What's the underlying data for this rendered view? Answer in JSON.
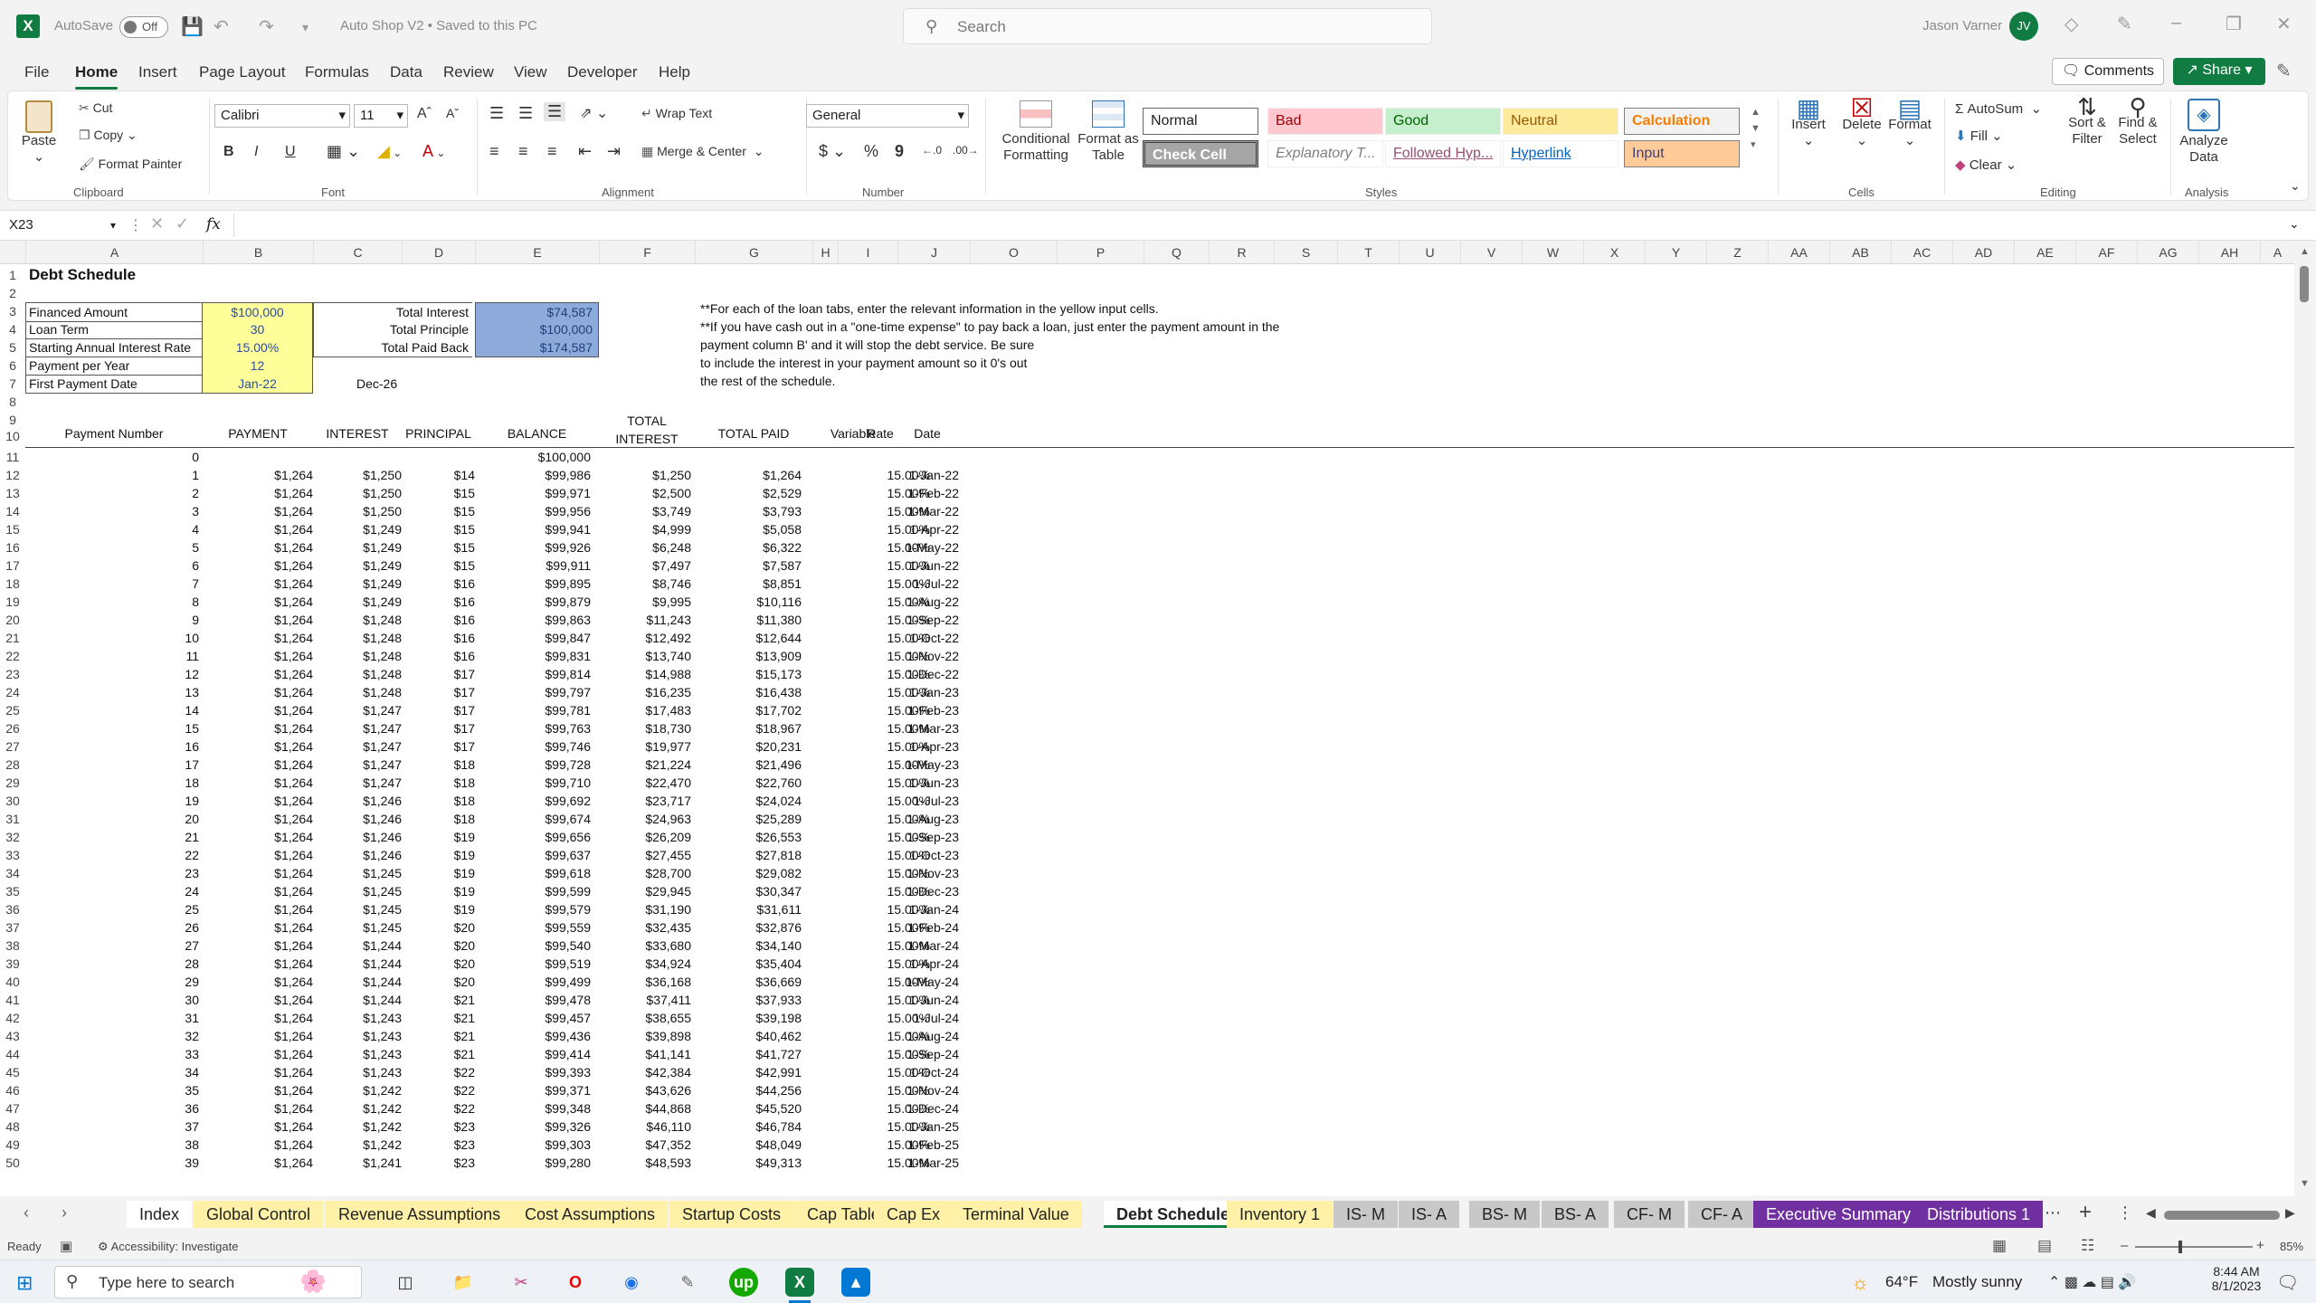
{
  "titlebar": {
    "autosave_label": "AutoSave",
    "autosave_state": "Off",
    "doc_title": "Auto Shop V2 • Saved to this PC",
    "search_placeholder": "Search",
    "user_name": "Jason Varner",
    "user_initials": "JV"
  },
  "menu": {
    "items": [
      "File",
      "Home",
      "Insert",
      "Page Layout",
      "Formulas",
      "Data",
      "Review",
      "View",
      "Developer",
      "Help"
    ],
    "comments": "Comments",
    "share": "Share"
  },
  "ribbon": {
    "clipboard": {
      "paste": "Paste",
      "cut": "Cut",
      "copy": "Copy",
      "format_painter": "Format Painter",
      "group": "Clipboard"
    },
    "font": {
      "name": "Calibri",
      "size": "11",
      "bold": "B",
      "italic": "I",
      "underline": "U",
      "group": "Font"
    },
    "alignment": {
      "wrap": "Wrap Text",
      "merge": "Merge & Center",
      "group": "Alignment"
    },
    "number": {
      "format": "General",
      "currency": "$",
      "percent": "%",
      "comma": "9",
      "group": "Number"
    },
    "styles": {
      "conditional": "Conditional Formatting",
      "format_table": "Format as Table",
      "normal": "Normal",
      "bad": "Bad",
      "good": "Good",
      "neutral": "Neutral",
      "calculation": "Calculation",
      "check": "Check Cell",
      "explanatory": "Explanatory T...",
      "followed": "Followed Hyp...",
      "hyperlink": "Hyperlink",
      "input": "Input",
      "group": "Styles"
    },
    "cells": {
      "insert": "Insert",
      "delete": "Delete",
      "format": "Format",
      "group": "Cells"
    },
    "editing": {
      "autosum": "AutoSum",
      "fill": "Fill",
      "clear": "Clear",
      "sort": "Sort & Filter",
      "find": "Find & Select",
      "group": "Editing"
    },
    "analysis": {
      "analyze": "Analyze Data",
      "group": "Analysis"
    }
  },
  "formula_bar": {
    "name_box": "X23",
    "fx": "fx",
    "value": ""
  },
  "columns": [
    "A",
    "B",
    "C",
    "D",
    "E",
    "F",
    "G",
    "H",
    "I",
    "J",
    "O",
    "P",
    "Q",
    "R",
    "S",
    "T",
    "U",
    "V",
    "W",
    "X",
    "Y",
    "Z",
    "AA",
    "AB",
    "AC",
    "AD",
    "AE",
    "AF",
    "AG",
    "AH",
    "A"
  ],
  "sheet": {
    "title": "Debt Schedule",
    "inputs": [
      {
        "label": "Financed Amount",
        "value": "$100,000"
      },
      {
        "label": "Loan Term",
        "value": "30"
      },
      {
        "label": "Starting Annual Interest Rate",
        "value": "15.00%"
      },
      {
        "label": "Payment per Year",
        "value": "12"
      },
      {
        "label": "First Payment Date",
        "value": "Jan-22"
      }
    ],
    "end_date": "Dec-26",
    "totals": [
      {
        "label": "Total Interest",
        "value": "$74,587"
      },
      {
        "label": "Total Principle",
        "value": "$100,000"
      },
      {
        "label": "Total Paid Back",
        "value": "$174,587"
      }
    ],
    "notes": [
      "**For each of the loan tabs, enter the relevant information in the yellow input cells.",
      "**If you have cash out in a \"one-time expense\" to pay back a loan, just enter the payment amount in the",
      "payment column B' and it will stop the debt service. Be sure",
      "to include the interest in your payment amount so it 0's out",
      "the rest of the schedule."
    ],
    "headers": {
      "payment_number": "Payment Number",
      "payment": "PAYMENT",
      "interest": "INTEREST",
      "principal": "PRINCIPAL",
      "balance": "BALANCE",
      "total_interest_1": "TOTAL",
      "total_interest_2": "INTEREST",
      "total_paid": "TOTAL PAID",
      "variable": "Variable",
      "rate": "Rate",
      "date": "Date"
    },
    "row0": {
      "n": "0",
      "balance": "$100,000"
    },
    "rows": [
      [
        "1",
        "$1,264",
        "$1,250",
        "$14",
        "$99,986",
        "$1,250",
        "$1,264",
        "15.00%",
        "1-Jan-22"
      ],
      [
        "2",
        "$1,264",
        "$1,250",
        "$15",
        "$99,971",
        "$2,500",
        "$2,529",
        "15.00%",
        "1-Feb-22"
      ],
      [
        "3",
        "$1,264",
        "$1,250",
        "$15",
        "$99,956",
        "$3,749",
        "$3,793",
        "15.00%",
        "1-Mar-22"
      ],
      [
        "4",
        "$1,264",
        "$1,249",
        "$15",
        "$99,941",
        "$4,999",
        "$5,058",
        "15.00%",
        "1-Apr-22"
      ],
      [
        "5",
        "$1,264",
        "$1,249",
        "$15",
        "$99,926",
        "$6,248",
        "$6,322",
        "15.00%",
        "1-May-22"
      ],
      [
        "6",
        "$1,264",
        "$1,249",
        "$15",
        "$99,911",
        "$7,497",
        "$7,587",
        "15.00%",
        "1-Jun-22"
      ],
      [
        "7",
        "$1,264",
        "$1,249",
        "$16",
        "$99,895",
        "$8,746",
        "$8,851",
        "15.00%",
        "1-Jul-22"
      ],
      [
        "8",
        "$1,264",
        "$1,249",
        "$16",
        "$99,879",
        "$9,995",
        "$10,116",
        "15.00%",
        "1-Aug-22"
      ],
      [
        "9",
        "$1,264",
        "$1,248",
        "$16",
        "$99,863",
        "$11,243",
        "$11,380",
        "15.00%",
        "1-Sep-22"
      ],
      [
        "10",
        "$1,264",
        "$1,248",
        "$16",
        "$99,847",
        "$12,492",
        "$12,644",
        "15.00%",
        "1-Oct-22"
      ],
      [
        "11",
        "$1,264",
        "$1,248",
        "$16",
        "$99,831",
        "$13,740",
        "$13,909",
        "15.00%",
        "1-Nov-22"
      ],
      [
        "12",
        "$1,264",
        "$1,248",
        "$17",
        "$99,814",
        "$14,988",
        "$15,173",
        "15.00%",
        "1-Dec-22"
      ],
      [
        "13",
        "$1,264",
        "$1,248",
        "$17",
        "$99,797",
        "$16,235",
        "$16,438",
        "15.00%",
        "1-Jan-23"
      ],
      [
        "14",
        "$1,264",
        "$1,247",
        "$17",
        "$99,781",
        "$17,483",
        "$17,702",
        "15.00%",
        "1-Feb-23"
      ],
      [
        "15",
        "$1,264",
        "$1,247",
        "$17",
        "$99,763",
        "$18,730",
        "$18,967",
        "15.00%",
        "1-Mar-23"
      ],
      [
        "16",
        "$1,264",
        "$1,247",
        "$17",
        "$99,746",
        "$19,977",
        "$20,231",
        "15.00%",
        "1-Apr-23"
      ],
      [
        "17",
        "$1,264",
        "$1,247",
        "$18",
        "$99,728",
        "$21,224",
        "$21,496",
        "15.00%",
        "1-May-23"
      ],
      [
        "18",
        "$1,264",
        "$1,247",
        "$18",
        "$99,710",
        "$22,470",
        "$22,760",
        "15.00%",
        "1-Jun-23"
      ],
      [
        "19",
        "$1,264",
        "$1,246",
        "$18",
        "$99,692",
        "$23,717",
        "$24,024",
        "15.00%",
        "1-Jul-23"
      ],
      [
        "20",
        "$1,264",
        "$1,246",
        "$18",
        "$99,674",
        "$24,963",
        "$25,289",
        "15.00%",
        "1-Aug-23"
      ],
      [
        "21",
        "$1,264",
        "$1,246",
        "$19",
        "$99,656",
        "$26,209",
        "$26,553",
        "15.00%",
        "1-Sep-23"
      ],
      [
        "22",
        "$1,264",
        "$1,246",
        "$19",
        "$99,637",
        "$27,455",
        "$27,818",
        "15.00%",
        "1-Oct-23"
      ],
      [
        "23",
        "$1,264",
        "$1,245",
        "$19",
        "$99,618",
        "$28,700",
        "$29,082",
        "15.00%",
        "1-Nov-23"
      ],
      [
        "24",
        "$1,264",
        "$1,245",
        "$19",
        "$99,599",
        "$29,945",
        "$30,347",
        "15.00%",
        "1-Dec-23"
      ],
      [
        "25",
        "$1,264",
        "$1,245",
        "$19",
        "$99,579",
        "$31,190",
        "$31,611",
        "15.00%",
        "1-Jan-24"
      ],
      [
        "26",
        "$1,264",
        "$1,245",
        "$20",
        "$99,559",
        "$32,435",
        "$32,876",
        "15.00%",
        "1-Feb-24"
      ],
      [
        "27",
        "$1,264",
        "$1,244",
        "$20",
        "$99,540",
        "$33,680",
        "$34,140",
        "15.00%",
        "1-Mar-24"
      ],
      [
        "28",
        "$1,264",
        "$1,244",
        "$20",
        "$99,519",
        "$34,924",
        "$35,404",
        "15.00%",
        "1-Apr-24"
      ],
      [
        "29",
        "$1,264",
        "$1,244",
        "$20",
        "$99,499",
        "$36,168",
        "$36,669",
        "15.00%",
        "1-May-24"
      ],
      [
        "30",
        "$1,264",
        "$1,244",
        "$21",
        "$99,478",
        "$37,411",
        "$37,933",
        "15.00%",
        "1-Jun-24"
      ],
      [
        "31",
        "$1,264",
        "$1,243",
        "$21",
        "$99,457",
        "$38,655",
        "$39,198",
        "15.00%",
        "1-Jul-24"
      ],
      [
        "32",
        "$1,264",
        "$1,243",
        "$21",
        "$99,436",
        "$39,898",
        "$40,462",
        "15.00%",
        "1-Aug-24"
      ],
      [
        "33",
        "$1,264",
        "$1,243",
        "$21",
        "$99,414",
        "$41,141",
        "$41,727",
        "15.00%",
        "1-Sep-24"
      ],
      [
        "34",
        "$1,264",
        "$1,243",
        "$22",
        "$99,393",
        "$42,384",
        "$42,991",
        "15.00%",
        "1-Oct-24"
      ],
      [
        "35",
        "$1,264",
        "$1,242",
        "$22",
        "$99,371",
        "$43,626",
        "$44,256",
        "15.00%",
        "1-Nov-24"
      ],
      [
        "36",
        "$1,264",
        "$1,242",
        "$22",
        "$99,348",
        "$44,868",
        "$45,520",
        "15.00%",
        "1-Dec-24"
      ],
      [
        "37",
        "$1,264",
        "$1,242",
        "$23",
        "$99,326",
        "$46,110",
        "$46,784",
        "15.00%",
        "1-Jan-25"
      ],
      [
        "38",
        "$1,264",
        "$1,242",
        "$23",
        "$99,303",
        "$47,352",
        "$48,049",
        "15.00%",
        "1-Feb-25"
      ],
      [
        "39",
        "$1,264",
        "$1,241",
        "$23",
        "$99,280",
        "$48,593",
        "$49,313",
        "15.00%",
        "1-Mar-25"
      ]
    ]
  },
  "tabs": [
    {
      "label": "Index",
      "color": "#ffffff"
    },
    {
      "label": "Global Control",
      "color": "#fff2a8"
    },
    {
      "label": "Revenue Assumptions",
      "color": "#fff2a8"
    },
    {
      "label": "Cost Assumptions",
      "color": "#fff2a8"
    },
    {
      "label": "Startup Costs",
      "color": "#fff2a8"
    },
    {
      "label": "Cap Table",
      "color": "#fff2a8"
    },
    {
      "label": "Cap Ex",
      "color": "#fff2a8"
    },
    {
      "label": "Terminal Value",
      "color": "#fff2a8"
    },
    {
      "label": "Debt Schedule",
      "color": "#ffffff"
    },
    {
      "label": "Inventory 1",
      "color": "#fff2a8"
    },
    {
      "label": "IS- M",
      "color": "#c8c8c8"
    },
    {
      "label": "IS- A",
      "color": "#c8c8c8"
    },
    {
      "label": "BS- M",
      "color": "#c8c8c8"
    },
    {
      "label": "BS- A",
      "color": "#c8c8c8"
    },
    {
      "label": "CF- M",
      "color": "#c8c8c8"
    },
    {
      "label": "CF- A",
      "color": "#c8c8c8"
    },
    {
      "label": "Executive Summary",
      "color": "#7030a0"
    },
    {
      "label": "Distributions 1",
      "color": "#7030a0"
    }
  ],
  "status": {
    "ready": "Ready",
    "accessibility": "Accessibility: Investigate",
    "zoom": "85%"
  },
  "taskbar": {
    "search": "Type here to search",
    "weather_temp": "64°F",
    "weather_desc": "Mostly sunny",
    "time": "8:44 AM",
    "date": "8/1/2023"
  }
}
